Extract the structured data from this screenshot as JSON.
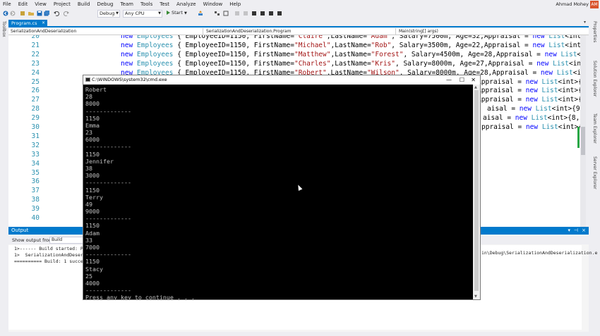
{
  "menu": {
    "items": [
      "File",
      "Edit",
      "View",
      "Project",
      "Build",
      "Debug",
      "Team",
      "Tools",
      "Test",
      "Analyze",
      "Window",
      "Help"
    ],
    "user": "Ahmad Mohey",
    "avatar": "AM"
  },
  "toolbar": {
    "config": "Debug",
    "platform": "Any CPU",
    "start_label": "Start"
  },
  "left_tab": "Toolbox",
  "right_tabs": [
    "Properties",
    "Solution Explorer",
    "Team Explorer",
    "Server Explorer"
  ],
  "doc_tab": "Program.cs",
  "nav": {
    "project": "SerializationAndDeserialization",
    "class": "SerializationAndDeserialization.Program",
    "member": "Main(string[] args)"
  },
  "editor": {
    "line_numbers": [
      "20",
      "21",
      "22",
      "23",
      "24",
      "25",
      "26",
      "27",
      "28",
      "29",
      "30",
      "31",
      "32",
      "33",
      "34",
      "35",
      "36",
      "37",
      "38",
      "39",
      "40"
    ],
    "lines": [
      {
        "kw": "new",
        "ty": "Employees",
        "a": " { EmployeeID=1150, FirstName=",
        "s1": "\"Claire\"",
        "b": ",LastName=",
        "s2": "\"Adam\"",
        "c": ", Salary=7500m, Age=32,Appraisal = ",
        "kw2": "new",
        "ty2": "List",
        "d": "<int>{9,7,4"
      },
      {
        "kw": "new",
        "ty": "Employees",
        "a": " { EmployeeID=1150, FirstName=",
        "s1": "\"Michael\"",
        "b": ",LastName=",
        "s2": "\"Rob\"",
        "c": ", Salary=3500m, Age=22,Appraisal = ",
        "kw2": "new",
        "ty2": "List",
        "d": "<int>{6,7,4"
      },
      {
        "kw": "new",
        "ty": "Employees",
        "a": " { EmployeeID=1150, FirstName=",
        "s1": "\"Matthew\"",
        "b": ",LastName=",
        "s2": "\"Forest\"",
        "c": ", Salary=4500m, Age=28,Appraisal = ",
        "kw2": "new",
        "ty2": "List",
        "d": "<int>{7,"
      },
      {
        "kw": "new",
        "ty": "Employees",
        "a": " { EmployeeID=1150, FirstName=",
        "s1": "\"Charles\"",
        "b": ",LastName=",
        "s2": "\"Kris\"",
        "c": ", Salary=8000m, Age=27,Appraisal = ",
        "kw2": "new",
        "ty2": "List",
        "d": "<int>{9,9"
      },
      {
        "kw": "new",
        "ty": "Employees",
        "a": " { EmployeeID=1150, FirstName=",
        "s1": "\"Robert\"",
        "b": ",LastName=",
        "s2": "\"Wilson\"",
        "c": ", Salary=8000m, Age=28,Appraisal = ",
        "kw2": "new",
        "ty2": "List",
        "d": "<int>{8,9"
      }
    ],
    "tails": [
      {
        "a": "Appraisal = ",
        "kw": "new",
        "ty": "List",
        "d": "<int>{8,9"
      },
      {
        "a": "Appraisal = ",
        "kw": "new",
        "ty": "List",
        "d": "<int>{8,6,9"
      },
      {
        "a": "Appraisal = ",
        "kw": "new",
        "ty": "List",
        "d": "<int>{8,6,9"
      },
      {
        "a": "aisal = ",
        "kw": "new",
        "ty": "List",
        "d": "<int>{9,9,9"
      },
      {
        "a": "aisal = ",
        "kw": "new",
        "ty": "List",
        "d": "<int>{8,8,"
      },
      {
        "a": "ppraisal = ",
        "kw": "new",
        "ty": "List",
        "d": "<int>{8,7,"
      }
    ]
  },
  "output": {
    "title": "Output",
    "show_from_label": "Show output from:",
    "show_from_value": "Build",
    "lines": [
      "1>------ Build started: Proj",
      "1>  SerializationAndDeseriali",
      "========== Build: 1 succeede"
    ],
    "right_text": "in\\Debug\\SerializationAndDeserialization.e"
  },
  "cmd": {
    "title": "C:\\WINDOWS\\system32\\cmd.exe",
    "lines": [
      "Robert",
      "28",
      "8000",
      "-------------",
      "1150",
      "Emma",
      "23",
      "6000",
      "-------------",
      "1150",
      "Jennifer",
      "38",
      "3000",
      "-------------",
      "1150",
      "Terry",
      "49",
      "9000",
      "-------------",
      "1150",
      "Adam",
      "33",
      "7000",
      "-------------",
      "1150",
      "Stacy",
      "25",
      "4000",
      "-------------",
      "Press any key to continue . . ."
    ]
  },
  "colors": {
    "accent": "#007acc",
    "keyword": "#0000ff",
    "type": "#2b91af",
    "string": "#a31515",
    "console_text": "#c0c0c0"
  }
}
